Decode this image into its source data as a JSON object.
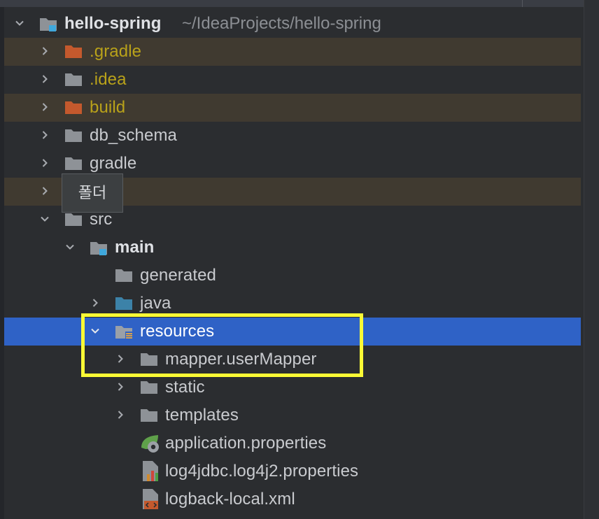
{
  "tree": {
    "root": {
      "name": "hello-spring",
      "path": "~/IdeaProjects/hello-spring"
    },
    "items": [
      {
        "label": ".gradle",
        "state": "excluded"
      },
      {
        "label": ".idea",
        "state": "excluded"
      },
      {
        "label": "build",
        "state": "excluded"
      },
      {
        "label": "db_schema"
      },
      {
        "label": "gradle"
      },
      {
        "label": "",
        "state": "excluded",
        "note": "row covered by tooltip"
      },
      {
        "label": "src"
      },
      {
        "label": "main"
      },
      {
        "label": "generated"
      },
      {
        "label": "java"
      },
      {
        "label": "resources",
        "selected": true
      },
      {
        "label": "mapper.userMapper"
      },
      {
        "label": "static"
      },
      {
        "label": "templates"
      },
      {
        "label": "application.properties"
      },
      {
        "label": "log4jdbc.log4j2.properties"
      },
      {
        "label": "logback-local.xml"
      }
    ]
  },
  "tooltip": {
    "text": "폴더"
  },
  "colors": {
    "background": "#2b2d30",
    "selection": "#2f62c6",
    "excluded_row": "#403a30",
    "excluded_text": "#b9a21a",
    "folder_gray": "#8e9297",
    "folder_orange": "#c4592d",
    "source_folder_blue": "#3c82a8",
    "module_marker": "#3fa8dc",
    "annotation_box": "#fafa35"
  },
  "icons": {
    "expand": "chevron-right-icon",
    "collapse": "chevron-down-icon",
    "folder": "folder-icon",
    "module": "module-folder-icon",
    "resources": "resources-folder-icon",
    "spring_properties": "spring-properties-file-icon",
    "properties": "properties-file-icon",
    "xml": "xml-file-icon"
  }
}
